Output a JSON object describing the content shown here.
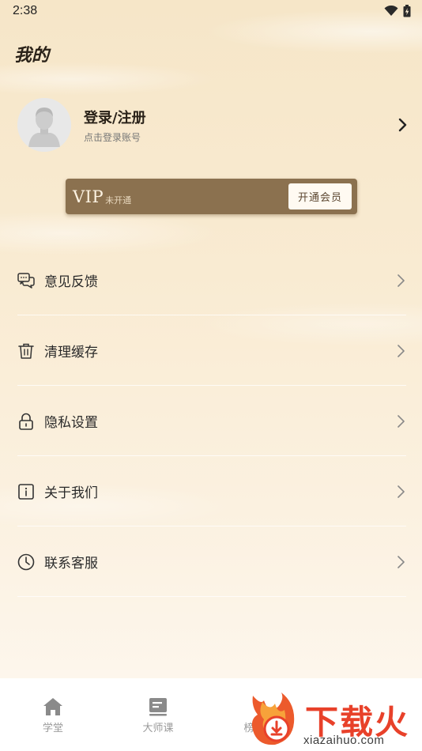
{
  "status_bar": {
    "time": "2:38"
  },
  "page": {
    "title": "我的"
  },
  "profile": {
    "login_label": "登录/注册",
    "login_sub": "点击登录账号"
  },
  "vip": {
    "label": "VIP",
    "status": "未开通",
    "button_label": "开通会员",
    "card_color": "#8b714f"
  },
  "menu": {
    "items": [
      {
        "label": "意见反馈",
        "icon": "feedback-icon"
      },
      {
        "label": "清理缓存",
        "icon": "trash-icon"
      },
      {
        "label": "隐私设置",
        "icon": "lock-icon"
      },
      {
        "label": "关于我们",
        "icon": "info-icon"
      },
      {
        "label": "联系客服",
        "icon": "clock-icon"
      }
    ]
  },
  "tabbar": {
    "tabs": [
      {
        "label": "学堂",
        "icon": "home-icon"
      },
      {
        "label": "大师课",
        "icon": "book-icon"
      },
      {
        "label": "榜",
        "icon": "rank-icon"
      }
    ]
  },
  "watermark": {
    "text": "下载火",
    "url": "xiazaihuo.com"
  }
}
